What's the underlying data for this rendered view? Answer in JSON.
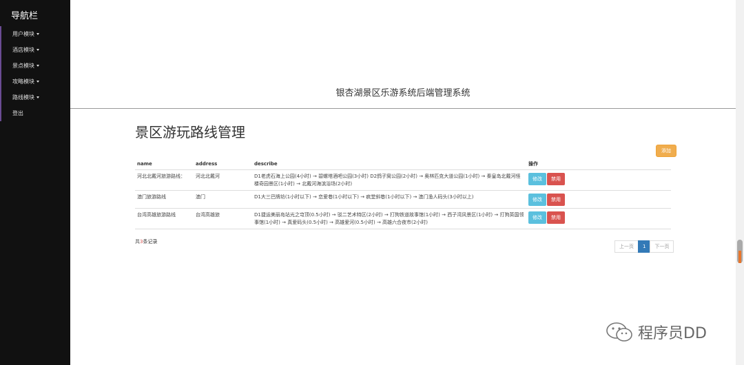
{
  "sidebar": {
    "brand": "导航栏",
    "items": [
      {
        "label": "用户模块"
      },
      {
        "label": "酒店模块"
      },
      {
        "label": "景点模块"
      },
      {
        "label": "攻略模块"
      },
      {
        "label": "路线模块"
      },
      {
        "label": "登出"
      }
    ]
  },
  "header": {
    "title": "银杏湖景区乐游系统后端管理系统"
  },
  "main": {
    "page_title": "景区游玩路线管理",
    "add_label": "添加",
    "columns": [
      "name",
      "address",
      "describe",
      "操作"
    ],
    "rows": [
      {
        "name": "河北北戴河旅游路线：",
        "address": "河北北戴河",
        "describe": "D1老虎石海上公园(4小时) → 碧螺塔酒吧公园(3小时) D2鸽子窝公园(2小时) → 奥林匹克大道公园(1小时) → 秦皇岛北戴河怪楼奇园景区(1小时) → 北戴河海滨浴场(2小时)"
      },
      {
        "name": "澳门旅游路线",
        "address": "澳门",
        "describe": "D1大三巴牌坊(1小时以下) → 恋爱巷(1小时以下) → 疯堂斜巷(1小时以下) → 澳门渔人码头(3小时以上)"
      },
      {
        "name": "台湾高雄旅游路线",
        "address": "台湾高雄旅",
        "describe": "D1捷运美丽岛站光之穹顶(0.5小时) → 驳二艺术特区(2小时) → 打狗铁道故事馆(1小时) → 西子湾风景区(1小时) → 打狗英国领事馆(1小时) → 真爱码头(0.5小时) → 高雄爱河(0.5小时) → 高雄六合夜市(2小时)"
      }
    ],
    "edit_label": "修改",
    "ban_label": "禁用",
    "records": {
      "prefix": "共",
      "count": "3",
      "suffix": "条记录"
    },
    "pagination": {
      "prev": "上一页",
      "current": "1",
      "next": "下一页"
    }
  },
  "watermark": {
    "text": "程序员DD"
  }
}
